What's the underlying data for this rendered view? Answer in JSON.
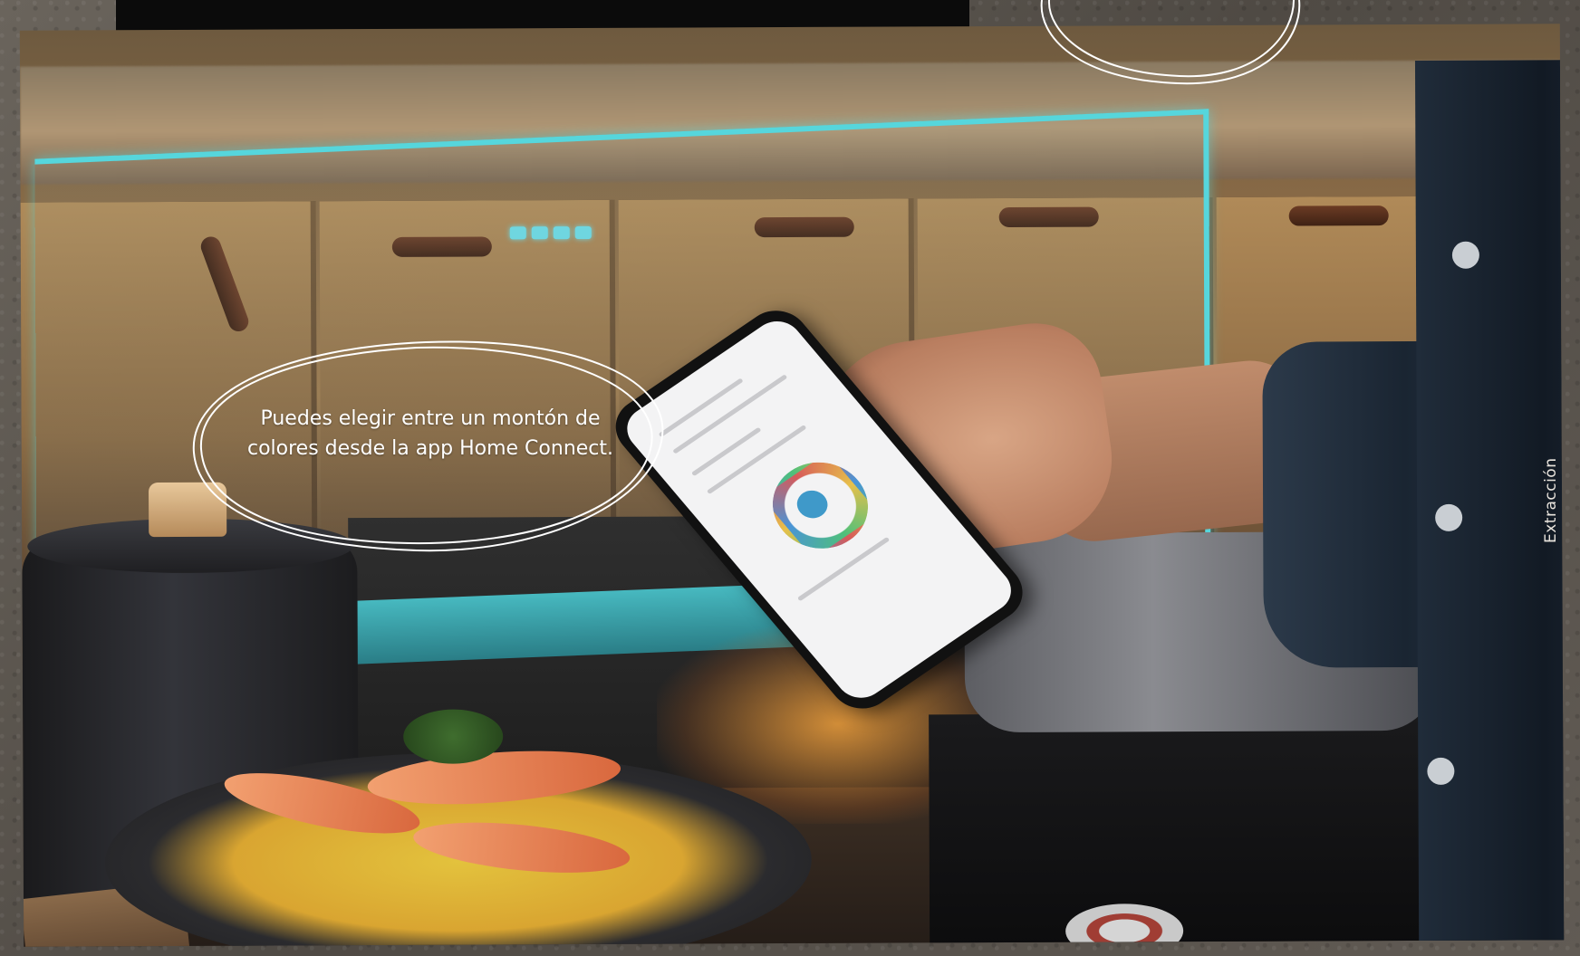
{
  "callout": {
    "text_line1": "Puedes elegir entre un montón de",
    "text_line2": "colores desde la app Home Connect."
  },
  "side_label": "Extracción",
  "colors": {
    "accent_light": "#56d6dc",
    "callout_stroke": "#ffffff",
    "top_bar": "#0b0b0b"
  }
}
